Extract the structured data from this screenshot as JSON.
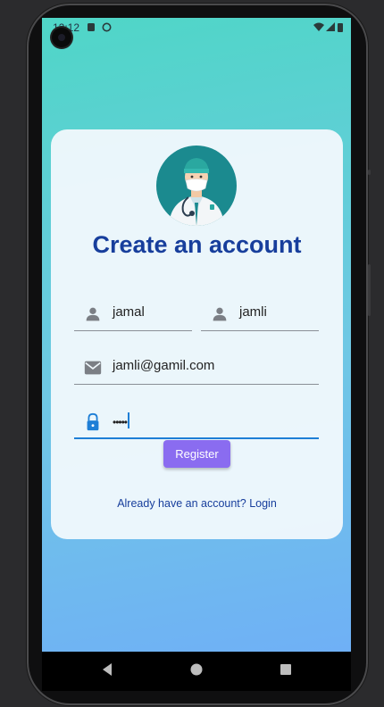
{
  "status_bar": {
    "time": "12:12"
  },
  "card": {
    "title": "Create an account",
    "fields": {
      "first_name": {
        "value": "jamal",
        "icon": "person-icon"
      },
      "last_name": {
        "value": "jamli",
        "icon": "person-icon"
      },
      "email": {
        "value": "jamli@gamil.com",
        "icon": "mail-icon"
      },
      "password": {
        "value": "•••••",
        "icon": "lock-icon"
      }
    },
    "register_label": "Register",
    "login_link": "Already have an account? Login"
  },
  "colors": {
    "accent": "#8a6cf0",
    "title": "#173e9c",
    "focus": "#1e7fd6"
  },
  "navigation": {
    "buttons": [
      "back-icon",
      "home-icon",
      "recents-icon"
    ]
  }
}
